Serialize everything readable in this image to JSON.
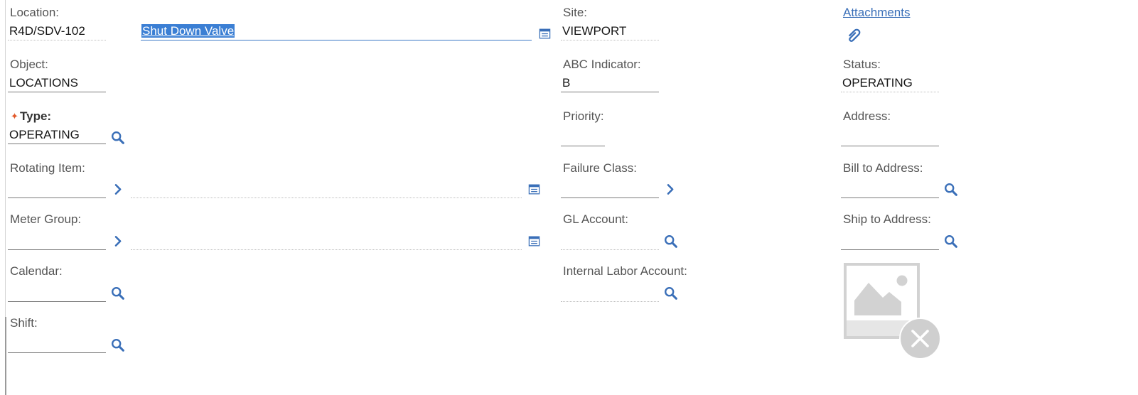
{
  "left_column": {
    "location": {
      "label": "Location:",
      "value": "R4D/SDV-102",
      "description": "Shut Down Valve"
    },
    "object": {
      "label": "Object:",
      "value": "LOCATIONS"
    },
    "type": {
      "label": "Type:",
      "value": "OPERATING",
      "required_marker": "✦"
    },
    "rotating_item": {
      "label": "Rotating Item:",
      "value": ""
    },
    "meter_group": {
      "label": "Meter Group:",
      "value": ""
    },
    "calendar": {
      "label": "Calendar:",
      "value": ""
    },
    "shift": {
      "label": "Shift:",
      "value": ""
    }
  },
  "middle_column": {
    "site": {
      "label": "Site:",
      "value": "VIEWPORT"
    },
    "abc_indicator": {
      "label": "ABC Indicator:",
      "value": "B"
    },
    "priority": {
      "label": "Priority:",
      "value": ""
    },
    "failure_class": {
      "label": "Failure Class:",
      "value": ""
    },
    "gl_account": {
      "label": "GL Account:",
      "value": ""
    },
    "internal_labor_account": {
      "label": "Internal Labor Account:",
      "value": ""
    }
  },
  "right_column": {
    "attachments": {
      "label": "Attachments"
    },
    "status": {
      "label": "Status:",
      "value": "OPERATING"
    },
    "address": {
      "label": "Address:",
      "value": ""
    },
    "bill_to_address": {
      "label": "Bill to Address:",
      "value": ""
    },
    "ship_to_address": {
      "label": "Ship to Address:",
      "value": ""
    }
  },
  "icons": {
    "lookup": "magnifier-icon",
    "detail_menu": "chevron-right-icon",
    "long_description": "long-description-icon",
    "attachment": "paperclip-icon",
    "image_placeholder": "image-placeholder-icon",
    "remove_image": "close-circle-icon"
  },
  "colors": {
    "icon_blue": "#3a6fb8",
    "selection": "#3b7fd4",
    "required": "#e2592a",
    "placeholder_grey": "#d2d2d2"
  }
}
